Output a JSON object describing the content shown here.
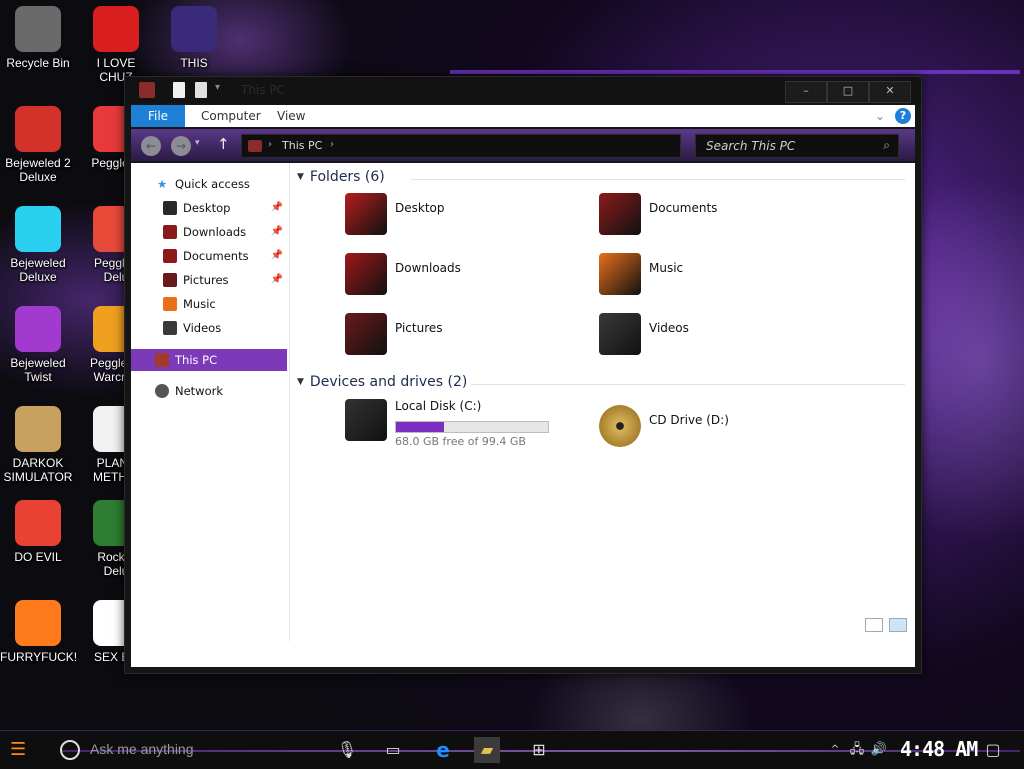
{
  "desktop": {
    "icons": [
      {
        "label": "Recycle Bin",
        "icon": "recycle-bin-icon",
        "color": "#6a6a6a"
      },
      {
        "label": "I LOVE\nCHUZ",
        "icon": "red-fuzzball-icon",
        "color": "#d81e1e"
      },
      {
        "label": "THIS",
        "icon": "goland-icon",
        "color": "#3a2b7a"
      },
      {
        "label": "Bejeweled 2\nDeluxe",
        "icon": "bejeweled2-icon",
        "color": "#d3322b"
      },
      {
        "label": "Peggle D",
        "icon": "peggle-icon",
        "color": "#e83a3a"
      },
      {
        "label": "Bejeweled\nDeluxe",
        "icon": "diamond-icon",
        "color": "#2ad0f0"
      },
      {
        "label": "Peggle I\nDelu",
        "icon": "peggle-icon",
        "color": "#e84a3a"
      },
      {
        "label": "Bejeweled\nTwist",
        "icon": "bejeweled-twist-icon",
        "color": "#a23ad0"
      },
      {
        "label": "Peggle W\nWarcraft",
        "icon": "peggle-icon",
        "color": "#f0a020"
      },
      {
        "label": "DARKOK\nSIMULATOR",
        "icon": "money-bag-icon",
        "color": "#c8a060"
      },
      {
        "label": "PLANT\nMETH U",
        "icon": "flower-icon",
        "color": "#f2f2f2"
      },
      {
        "label": "DO EVIL",
        "icon": "chrome-icon",
        "color": "#e94235"
      },
      {
        "label": "Rocket\nDelu",
        "icon": "rocket-icon",
        "color": "#2e7d32"
      },
      {
        "label": "FURRYFUCK!",
        "icon": "firefox-icon",
        "color": "#ff7a1a"
      },
      {
        "label": "SEX ED",
        "icon": "hx-icon",
        "color": "#ffffff"
      }
    ]
  },
  "window": {
    "title": "This PC",
    "controls": {
      "minimize": "–",
      "maximize": "□",
      "close": "✕"
    }
  },
  "ribbon": {
    "tabs": [
      "File",
      "Computer",
      "View"
    ],
    "collapse": "⌄",
    "help": "?"
  },
  "address": {
    "breadcrumb": "This PC",
    "search_placeholder": "Search This PC"
  },
  "nav": {
    "quick_access": "Quick access",
    "items": [
      {
        "label": "Desktop",
        "pinned": true
      },
      {
        "label": "Downloads",
        "pinned": true
      },
      {
        "label": "Documents",
        "pinned": true
      },
      {
        "label": "Pictures",
        "pinned": true
      },
      {
        "label": "Music",
        "pinned": false
      },
      {
        "label": "Videos",
        "pinned": false
      }
    ],
    "this_pc": "This PC",
    "network": "Network"
  },
  "content": {
    "folders_header": "Folders (6)",
    "folders": [
      {
        "name": "Desktop",
        "color": "#b51d1d"
      },
      {
        "name": "Documents",
        "color": "#8b1b1b"
      },
      {
        "name": "Downloads",
        "color": "#a01818"
      },
      {
        "name": "Music",
        "color": "#e8701a"
      },
      {
        "name": "Pictures",
        "color": "#6a1a1a"
      },
      {
        "name": "Videos",
        "color": "#3a3a3a"
      }
    ],
    "devices_header": "Devices and drives (2)",
    "drives": [
      {
        "name": "Local Disk (C:)",
        "free_text": "68.0 GB free of 99.4 GB",
        "used_fraction": 0.316
      },
      {
        "name": "CD Drive (D:)"
      }
    ]
  },
  "taskbar": {
    "search_text": "Ask me anything",
    "clock": "4:48 AM"
  }
}
